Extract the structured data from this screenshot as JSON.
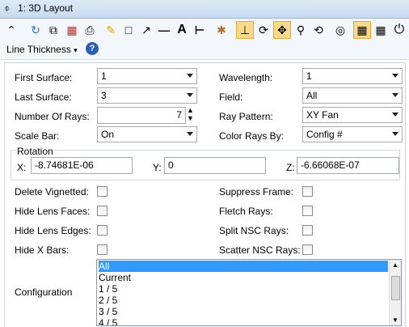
{
  "window": {
    "title": "1: 3D Layout"
  },
  "toolbar": {
    "line_thickness": "Line Thickness"
  },
  "fields": {
    "first_surface": {
      "label": "First Surface:",
      "value": "1"
    },
    "last_surface": {
      "label": "Last Surface:",
      "value": "3"
    },
    "number_of_rays": {
      "label": "Number Of Rays:",
      "value": "7"
    },
    "scale_bar": {
      "label": "Scale Bar:",
      "value": "On"
    },
    "wavelength": {
      "label": "Wavelength:",
      "value": "1"
    },
    "field": {
      "label": "Field:",
      "value": "All"
    },
    "ray_pattern": {
      "label": "Ray Pattern:",
      "value": "XY Fan"
    },
    "color_rays_by": {
      "label": "Color Rays By:",
      "value": "Config #"
    }
  },
  "rotation": {
    "label": "Rotation",
    "x_label": "X:",
    "x_value": "-8.74681E-06",
    "y_label": "Y:",
    "y_value": "0",
    "z_label": "Z:",
    "z_value": "-6.66068E-07"
  },
  "checkboxes": {
    "delete_vignetted": "Delete Vignetted:",
    "hide_lens_faces": "Hide Lens Faces:",
    "hide_lens_edges": "Hide Lens Edges:",
    "hide_x_bars": "Hide X Bars:",
    "suppress_frame": "Suppress Frame:",
    "fletch_rays": "Fletch Rays:",
    "split_nsc_rays": "Split NSC Rays:",
    "scatter_nsc_rays": "Scatter NSC Rays:"
  },
  "configuration": {
    "label": "Configuration",
    "options": [
      "All",
      "Current",
      "1 / 5",
      "2 / 5",
      "3 / 5",
      "4 / 5"
    ],
    "selected": "All"
  },
  "colors": {
    "selection": "#3399ff",
    "active_tool": "#fbd98a"
  }
}
